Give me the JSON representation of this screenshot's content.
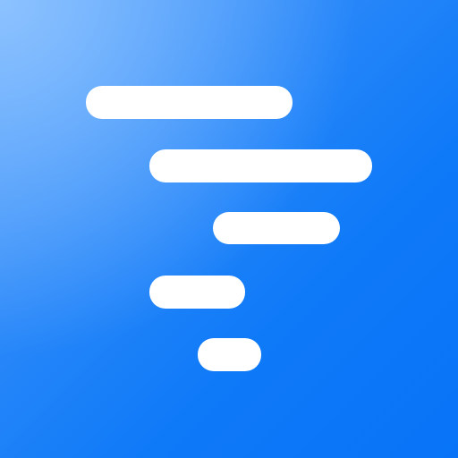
{
  "app_icon": {
    "icon_name": "tornado-funnel-icon",
    "background_color": "#0a78f8",
    "bar_color": "#ffffff",
    "bars": [
      "bar-1",
      "bar-2",
      "bar-3",
      "bar-4",
      "bar-5"
    ]
  }
}
